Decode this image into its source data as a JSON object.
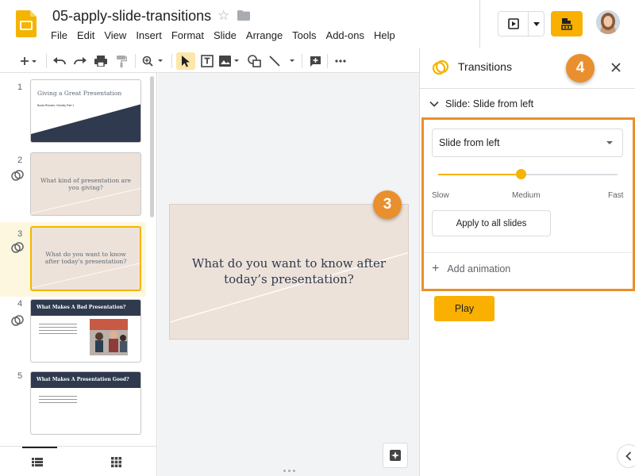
{
  "document": {
    "title": "05-apply-slide-transitions"
  },
  "menu": [
    "File",
    "Edit",
    "View",
    "Insert",
    "Format",
    "Slide",
    "Arrange",
    "Tools",
    "Add-ons",
    "Help"
  ],
  "toolbar": [
    "new-slide",
    "undo",
    "redo",
    "print",
    "paint-format",
    "zoom",
    "select",
    "text-box",
    "image",
    "shape",
    "line",
    "comment",
    "more"
  ],
  "slides": [
    {
      "number": "1",
      "title": "Giving a Great Presentation",
      "subtitle": "Busta Rhodes: Velocity Part 1"
    },
    {
      "number": "2",
      "title": "What kind of presentation are you giving?"
    },
    {
      "number": "3",
      "title": "What do you want to know after today’s presentation?"
    },
    {
      "number": "4",
      "title": "What Makes A Bad Presentation?"
    },
    {
      "number": "5",
      "title": "What Makes A Presentation Good?"
    }
  ],
  "main_slide": {
    "text": "What do you want to know after today’s presentation?"
  },
  "panel": {
    "title": "Transitions",
    "section_label": "Slide: Slide from left",
    "transition_select": "Slide from left",
    "speed": {
      "slow": "Slow",
      "medium": "Medium",
      "fast": "Fast",
      "value": 0.46
    },
    "apply_all": "Apply to all slides",
    "add_animation": "Add animation",
    "play": "Play"
  },
  "callouts": {
    "three": "3",
    "four": "4"
  },
  "colors": {
    "accent": "#f4b400",
    "callout": "#e98f2d",
    "slide_bg": "#ede2d9",
    "slide_dark": "#2f3a4e"
  }
}
